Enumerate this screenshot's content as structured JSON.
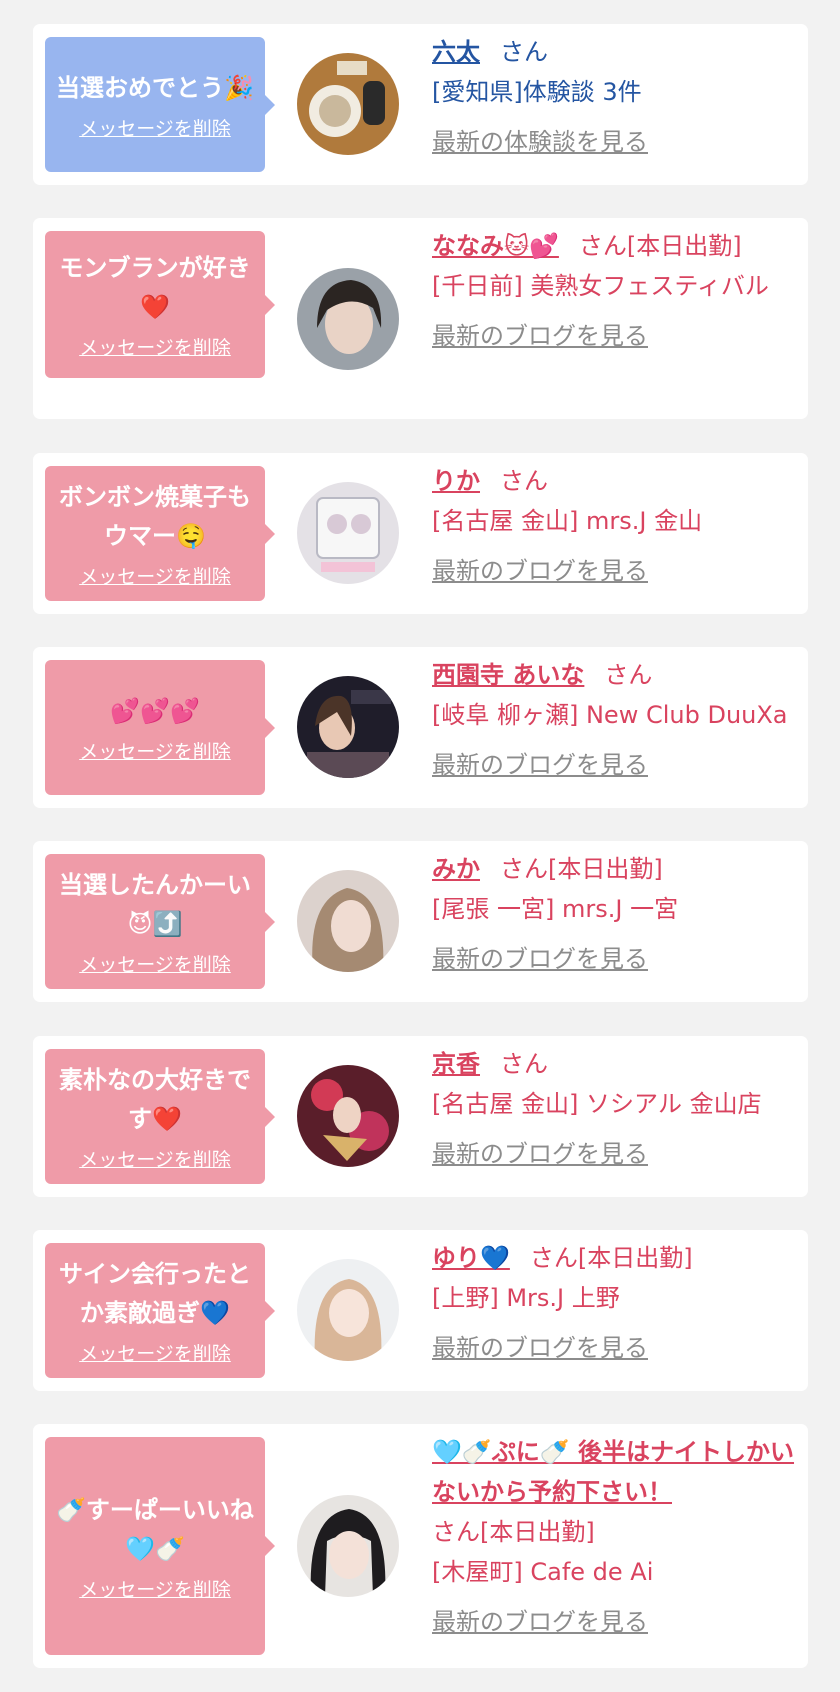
{
  "delete_label": "メッセージを削除",
  "entries": [
    {
      "message": "当選おめでとう🎉",
      "name": "六太",
      "suffix": "さん",
      "shop": "[愛知県]体験談 3件",
      "link": "最新の体験談を見る"
    },
    {
      "message": "モンブランが好き❤️",
      "name": "ななみ🐱💕",
      "suffix": "さん[本日出勤]",
      "shop": "[千日前] 美熟女フェスティバル",
      "link": "最新のブログを見る"
    },
    {
      "message": "ボンボン焼菓子もウマー🤤",
      "name": "りか",
      "suffix": "さん",
      "shop": "[名古屋 金山] mrs.J 金山",
      "link": "最新のブログを見る"
    },
    {
      "message": "💕💕💕",
      "name": "西園寺 あいな",
      "suffix": "さん",
      "shop": "[岐阜 柳ヶ瀬] New Club DuuXa",
      "link": "最新のブログを見る"
    },
    {
      "message": "当選したんかーい😈⤴️",
      "name": "みか",
      "suffix": "さん[本日出勤]",
      "shop": "[尾張 一宮] mrs.J 一宮",
      "link": "最新のブログを見る"
    },
    {
      "message": "素朴なの大好きです❤️",
      "name": "京香",
      "suffix": "さん",
      "shop": "[名古屋 金山] ソシアル 金山店",
      "link": "最新のブログを見る"
    },
    {
      "message": "サイン会行ったとか素敵過ぎ💙",
      "name": "ゆり💙",
      "suffix": "さん[本日出勤]",
      "shop": "[上野] Mrs.J 上野",
      "link": "最新のブログを見る"
    },
    {
      "message": "🍼すーぱーいいね🩵🍼",
      "name": "🩵🍼ぷに🍼 後半はナイトしかいないから予約下さい！",
      "suffix": "さん[本日出勤]",
      "shop": "[木屋町] Cafe de Ai",
      "link": "最新のブログを見る"
    }
  ],
  "colors": {
    "page_bg": "#f2f2f2",
    "bubble_blue": "#98b5ef",
    "bubble_pink": "#ef9ba8",
    "name_pink": "#d9435f",
    "name_blue": "#2455a2",
    "link_gray": "#8c8c8c"
  }
}
